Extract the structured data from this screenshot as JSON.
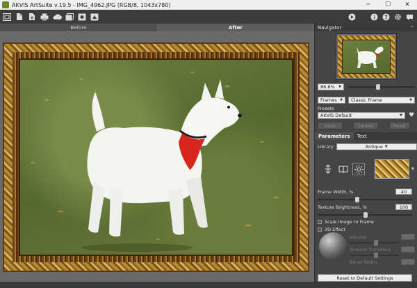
{
  "window": {
    "title": "AKVIS ArtSuite v.19.5 - IMG_4962.JPG (RGB/8, 1043x780)",
    "minimize": "─",
    "maximize": "☐",
    "close": "✕"
  },
  "toolbar": {
    "left_icons": [
      "open-image-icon",
      "open-file-icon",
      "save-file-icon",
      "print-icon",
      "cloud-icon",
      "batch-icon",
      "presets-icon",
      "share-icon"
    ],
    "right_icons": [
      "run-icon",
      "info-icon",
      "help-icon",
      "settings-icon",
      "notifications-icon"
    ]
  },
  "view_tabs": {
    "before": "Before",
    "after": "After"
  },
  "navigator": {
    "title": "Navigator",
    "collapse": "⌃",
    "zoom": "86.8%"
  },
  "effect_selectors": {
    "effect": "Frames",
    "frame_type": "Classic Frame"
  },
  "presets": {
    "label": "Presets",
    "current": "AKVIS Default",
    "save": "Save",
    "delete": "Delete",
    "reset": "Reset"
  },
  "settings_tabs": {
    "parameters": "Parameters",
    "text": "Text"
  },
  "library": {
    "label": "Library",
    "value": "Antique"
  },
  "frame_width": {
    "label": "Frame Width, %",
    "value": "40",
    "level_percent": 40
  },
  "texture_brightness": {
    "label": "Texture Brightness, %",
    "value": "100",
    "level_percent": 100
  },
  "options": {
    "scale_image": "Scale Image to Frame",
    "effect_3d": "3D Effect"
  },
  "effect_3d_params": {
    "volume": "Volume",
    "smooth_transition": "Smooth Transition",
    "bevel_width": "Bevel Width"
  },
  "reset_defaults": "Reset to Default Settings",
  "colors": {
    "frame_gold": "#b88a34",
    "frame_dark": "#7a5218",
    "collar_red": "#d8261e",
    "panel_bg": "#454545"
  }
}
